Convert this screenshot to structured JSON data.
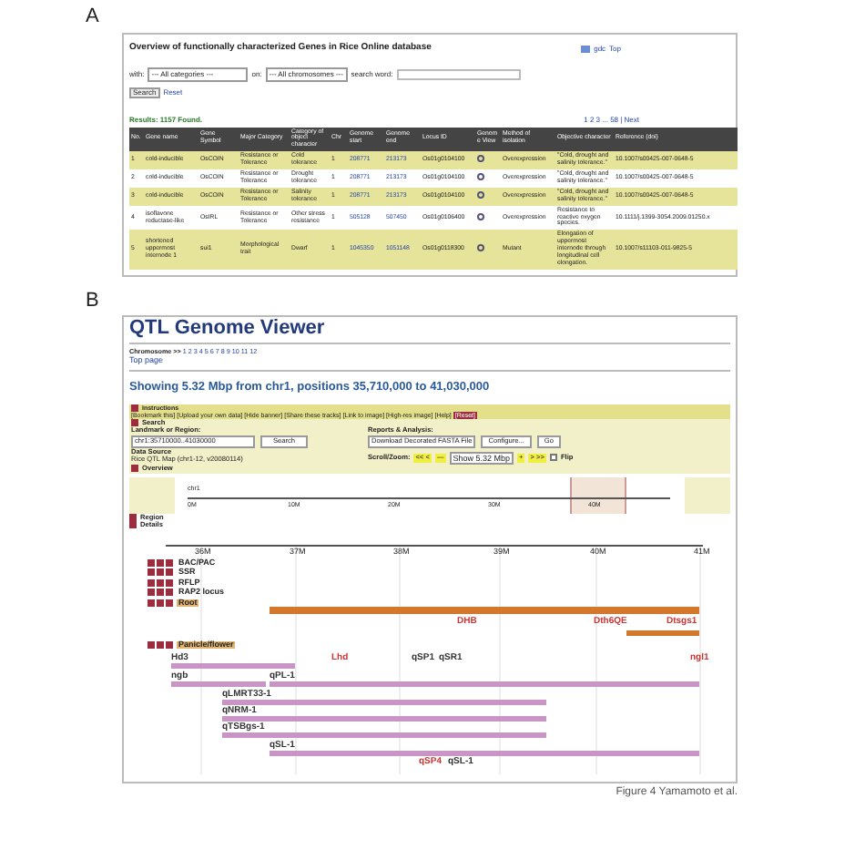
{
  "panel_a": {
    "label": "A",
    "title": "Overview of functionally characterized Genes in Rice Online database",
    "top_links": [
      "gdc",
      "Top"
    ],
    "filters": {
      "with_label": "with:",
      "category": "--- All categories ---",
      "on_label": "on:",
      "chromosome": "--- All chromosomes ---",
      "search_label": "search word:"
    },
    "buttons": [
      "Search",
      "Reset"
    ],
    "results": "Results:  1157 Found.",
    "pager": "1 2 3 ... 58 | Next",
    "table": {
      "columns": [
        "No.",
        "Gene name",
        "Gene Symbol",
        "Major Category",
        "Category of object character",
        "Chr",
        "Genome start",
        "Genome end",
        "Locus ID",
        "Genome View",
        "Method of isolation",
        "Objective character",
        "Reference (doi)"
      ],
      "rows": [
        [
          "1",
          "cold-inducible",
          "OsCOIN",
          "Resistance or Tolerance",
          "Cold tolerance",
          "1",
          "208771",
          "213173",
          "Os01g0104100",
          "",
          "Overexpression",
          "\"Cold, drought and salinity tolerance.\"",
          "10.1007/s00425-007-0648-5"
        ],
        [
          "2",
          "cold-inducible",
          "OsCOIN",
          "Resistance or Tolerance",
          "Drought tolerance",
          "1",
          "208771",
          "213173",
          "Os01g0104100",
          "",
          "Overexpression",
          "\"Cold, drought and salinity tolerance.\"",
          "10.1007/s00425-007-0648-5"
        ],
        [
          "3",
          "cold-inducible",
          "OsCOIN",
          "Resistance or Tolerance",
          "Salinity tolerance",
          "1",
          "208771",
          "213173",
          "Os01g0104100",
          "",
          "Overexpression",
          "\"Cold, drought and salinity tolerance.\"",
          "10.1007/s00425-007-0648-5"
        ],
        [
          "4",
          "isoflavone reductase-like",
          "OsIRL",
          "Resistance or Tolerance",
          "Other stress resistance",
          "1",
          "505128",
          "507450",
          "Os01g0106400",
          "",
          "Overexpression",
          "Resistance to reactive oxygen species.",
          "10.1111/j.1399-3054.2009.01250.x"
        ],
        [
          "5",
          "shortened uppermost internode 1",
          "sui1",
          "Morphological trait",
          "Dwarf",
          "1",
          "1045350",
          "1051148",
          "Os01g0118300",
          "",
          "Mutant",
          "Elongation of uppermost internode through longitudinal cell elongation.",
          "10.1007/s11103-011-9825-5"
        ]
      ]
    }
  },
  "panel_b": {
    "label": "B",
    "title": "QTL Genome Viewer",
    "chromosome_label": "Chromosome >>",
    "chromosomes": [
      "1",
      "2",
      "3",
      "4",
      "5",
      "6",
      "7",
      "8",
      "9",
      "10",
      "11",
      "12"
    ],
    "top_page": "Top page",
    "heading": "Showing 5.32 Mbp from chr1, positions 35,710,000 to 41,030,000",
    "instructions": {
      "title": "Instructions",
      "links": [
        "[Bookmark this]",
        "[Upload your own data]",
        "[Hide banner]",
        "[Share these tracks]",
        "[Link to image]",
        "[High-res image]",
        "[Help]"
      ],
      "reset": "[Reset]"
    },
    "search": {
      "title": "Search",
      "landmark_label": "Landmark or Region:",
      "landmark_value": "chr1:35710000..41030000",
      "search_button": "Search",
      "source_label": "Data Source",
      "source_value": "Rice QTL Map (chr1-12, v20080114)",
      "reports_label": "Reports & Analysis:",
      "reports_select": "Download Decorated FASTA File",
      "configure_button": "Configure...",
      "go_button": "Go",
      "scroll_label": "Scroll/Zoom:",
      "scroll_left": "<< <",
      "zoom_out": "—",
      "zoom_select": "Show 5.32 Mbp",
      "zoom_in": "+",
      "scroll_right": "> >>",
      "flip": {
        "label": "Flip",
        "checked": false
      }
    },
    "overview": {
      "title": "Overview",
      "chromosome": "chr1",
      "ticks": [
        "0M",
        "10M",
        "20M",
        "30M",
        "40M"
      ]
    },
    "region": {
      "title": "Region"
    },
    "details": {
      "title": "Details",
      "ticks": [
        "36M",
        "37M",
        "38M",
        "39M",
        "40M",
        "41M"
      ],
      "tracks": [
        {
          "name": "BAC/PAC"
        },
        {
          "name": "SSR"
        },
        {
          "name": "RFLP"
        },
        {
          "name": "RAP2 locus"
        },
        {
          "name": "Root",
          "features": [
            {
              "label": "DHB",
              "color": "#cc3333"
            },
            {
              "label": "Dth6QE",
              "color": "#cc3333"
            },
            {
              "label": "Dtsgs1",
              "color": "#cc3333"
            }
          ]
        },
        {
          "name": "Panicle/flower",
          "features": [
            {
              "label": "Hd3",
              "color": "#333333"
            },
            {
              "label": "Lhd",
              "color": "#cc3333"
            },
            {
              "label": "qSP1",
              "color": "#333333"
            },
            {
              "label": "qSR1",
              "color": "#333333"
            },
            {
              "label": "ngl1",
              "color": "#cc3333"
            },
            {
              "label": "ngb",
              "color": "#333333"
            },
            {
              "label": "qPL-1",
              "color": "#333333"
            },
            {
              "label": "qLMRT33-1",
              "color": "#333333"
            },
            {
              "label": "qNRM-1",
              "color": "#333333"
            },
            {
              "label": "qTSBgs-1",
              "color": "#333333"
            },
            {
              "label": "qSL-1",
              "color": "#333333"
            },
            {
              "label": "qSP4",
              "color": "#cc3333"
            },
            {
              "label": "qSL-1",
              "color": "#333333"
            }
          ]
        }
      ]
    }
  },
  "caption": "Figure 4  Yamamoto et al."
}
